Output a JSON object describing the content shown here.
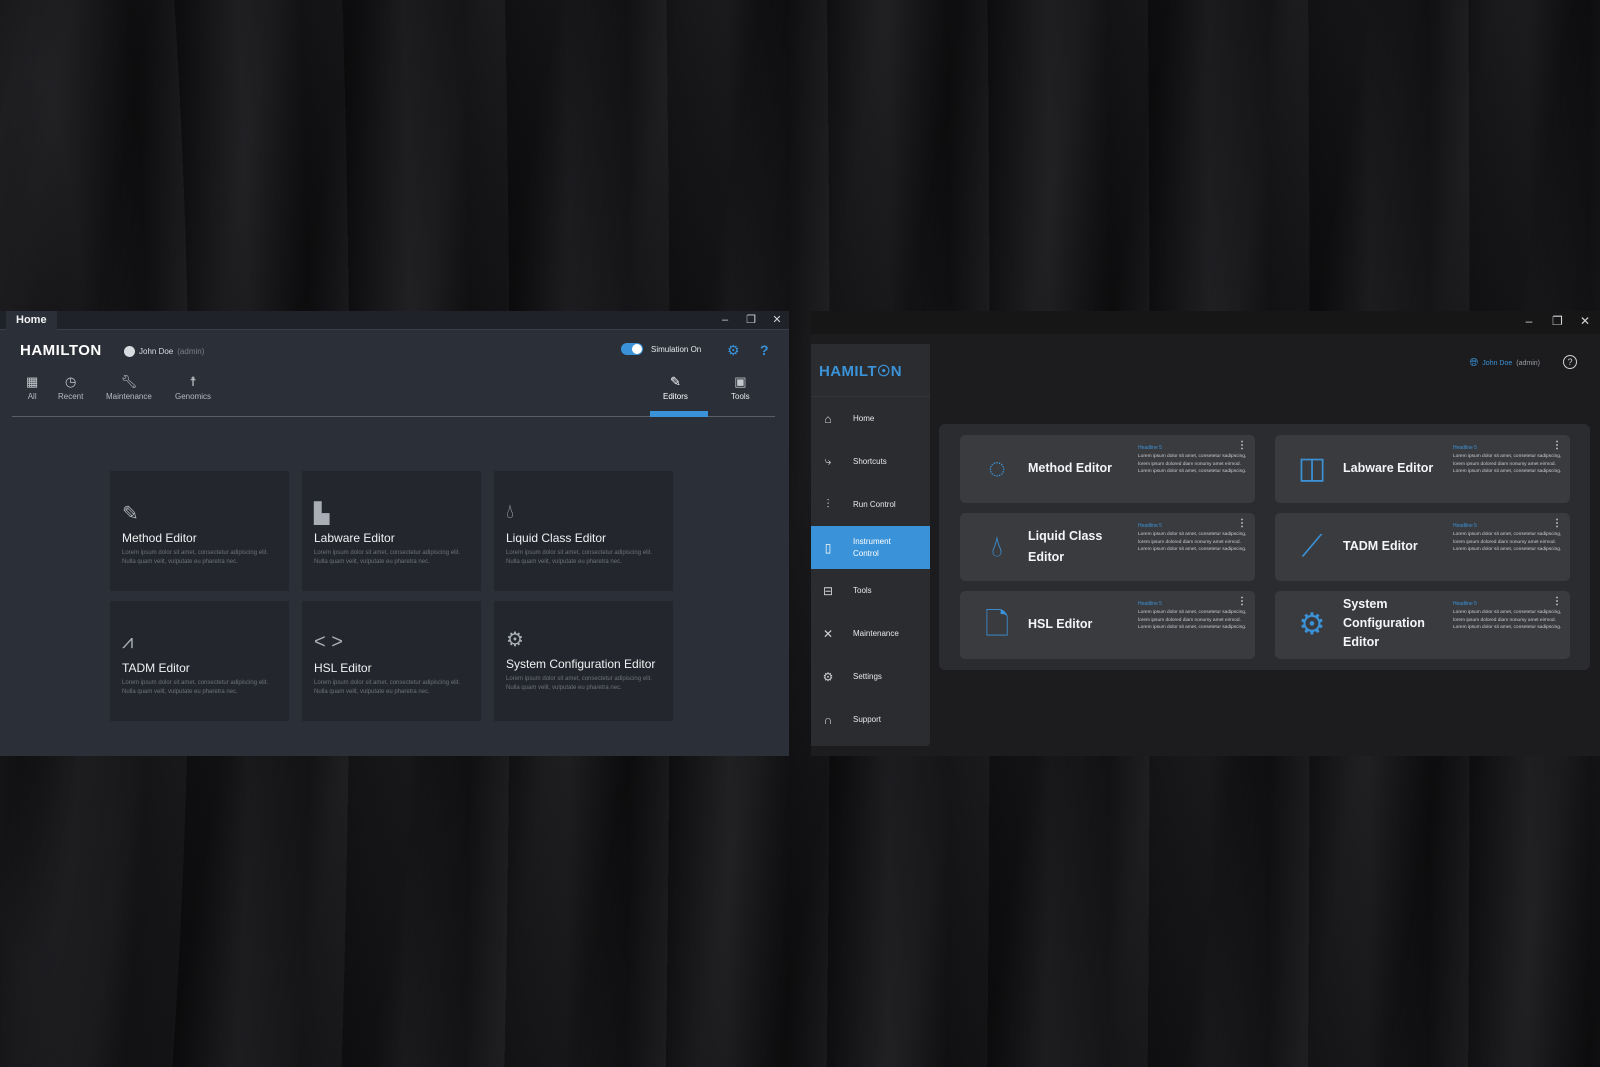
{
  "left_window": {
    "tab_title": "Home",
    "window_controls": [
      "–",
      "❐",
      "✕"
    ],
    "logo": "HAMILTON",
    "user_name": "John Doe",
    "user_role": "(admin)",
    "simulation_label": "Simulation On",
    "toolbar": [
      {
        "label": "All",
        "icon": "grid-icon"
      },
      {
        "label": "Recent",
        "icon": "history-icon"
      },
      {
        "label": "Maintenance",
        "icon": "wrench-icon"
      },
      {
        "label": "Genomics",
        "icon": "genomics-icon"
      },
      {
        "label": "Editors",
        "icon": "pencil-icon"
      },
      {
        "label": "Tools",
        "icon": "toolbox-icon"
      }
    ],
    "active_tab": "Editors",
    "cards": [
      {
        "title": "Method Editor",
        "desc": "Lorem ipsum dolor sit amet, consectetur adipiscing elit. Nulla quam velit, vulputate eu pharetra nec.",
        "icon": "pencil-icon"
      },
      {
        "title": "Labware Editor",
        "desc": "Lorem ipsum dolor sit amet, consectetur adipiscing elit. Nulla quam velit, vulputate eu pharetra nec.",
        "icon": "layout-icon"
      },
      {
        "title": "Liquid Class Editor",
        "desc": "Lorem ipsum dolor sit amet, consectetur adipiscing elit. Nulla quam velit, vulputate eu pharetra nec.",
        "icon": "drop-icon"
      },
      {
        "title": "TADM Editor",
        "desc": "Lorem ipsum dolor sit amet, consectetur adipiscing elit. Nulla quam velit, vulputate eu pharetra nec.",
        "icon": "trend-icon"
      },
      {
        "title": "HSL Editor",
        "desc": "Lorem ipsum dolor sit amet, consectetur adipiscing elit. Nulla quam velit, vulputate eu pharetra nec.",
        "icon": "code-icon"
      },
      {
        "title": "System Configuration Editor",
        "desc": "Lorem ipsum dolor sit amet, consectetur adipiscing elit. Nulla quam velit, vulputate eu pharetra nec.",
        "icon": "gear-icon"
      }
    ]
  },
  "right_window": {
    "logo": "HAMILT☉N",
    "user_name": "John Doe",
    "user_role": "(admin)",
    "nav": [
      {
        "label": "Home",
        "icon": "home-icon"
      },
      {
        "label": "Shortcuts",
        "icon": "shortcuts-icon"
      },
      {
        "label": "Run Control",
        "icon": "sliders-icon"
      },
      {
        "label": "Instrument Control",
        "icon": "instrument-icon"
      },
      {
        "label": "Tools",
        "icon": "toolbox-icon"
      },
      {
        "label": "Maintenance",
        "icon": "tools-icon"
      },
      {
        "label": "Settings",
        "icon": "settings-icon"
      },
      {
        "label": "Support",
        "icon": "headset-icon"
      }
    ],
    "active_nav": "Instrument Control",
    "tiles": [
      {
        "title": "Method Editor",
        "headline": "Headline 5",
        "desc": "Lorem ipsum dolor sit amet, consetetur sadipscing, lorem ipsum dolored diam nonumy amet eirmod. Lorem ipsum dolor sit amet, consetetur sadipscing.",
        "icon": "method-icon"
      },
      {
        "title": "Labware Editor",
        "headline": "Headline 5",
        "desc": "Lorem ipsum dolor sit amet, consetetur sadipscing, lorem ipsum dolored diam nonumy amet eirmod. Lorem ipsum dolor sit amet, consetetur sadipscing.",
        "icon": "layout-icon"
      },
      {
        "title": "Liquid Class Editor",
        "headline": "Headline 5",
        "desc": "Lorem ipsum dolor sit amet, consetetur sadipscing, lorem ipsum dolored diam nonumy amet eirmod. Lorem ipsum dolor sit amet, consetetur sadipscing.",
        "icon": "drop-icon"
      },
      {
        "title": "TADM Editor",
        "headline": "Headline 5",
        "desc": "Lorem ipsum dolor sit amet, consetetur sadipscing, lorem ipsum dolored diam nonumy amet eirmod. Lorem ipsum dolor sit amet, consetetur sadipscing.",
        "icon": "trend-icon"
      },
      {
        "title": "HSL Editor",
        "headline": "Headline 5",
        "desc": "Lorem ipsum dolor sit amet, consetetur sadipscing, lorem ipsum dolored diam nonumy amet eirmod. Lorem ipsum dolor sit amet, consetetur sadipscing.",
        "icon": "code-file-icon"
      },
      {
        "title": "System Configuration Editor",
        "headline": "Headline 5",
        "desc": "Lorem ipsum dolor sit amet, consetetur sadipscing, lorem ipsum dolored diam nonumy amet eirmod. Lorem ipsum dolor sit amet, consetetur sadipscing.",
        "icon": "gear-icon"
      }
    ]
  },
  "colors": {
    "accent": "#3a93d9",
    "left_bg": "#2b2f38",
    "left_card": "#23262c",
    "right_bg": "#1c1c1e",
    "right_tile": "#3a3b3f"
  }
}
